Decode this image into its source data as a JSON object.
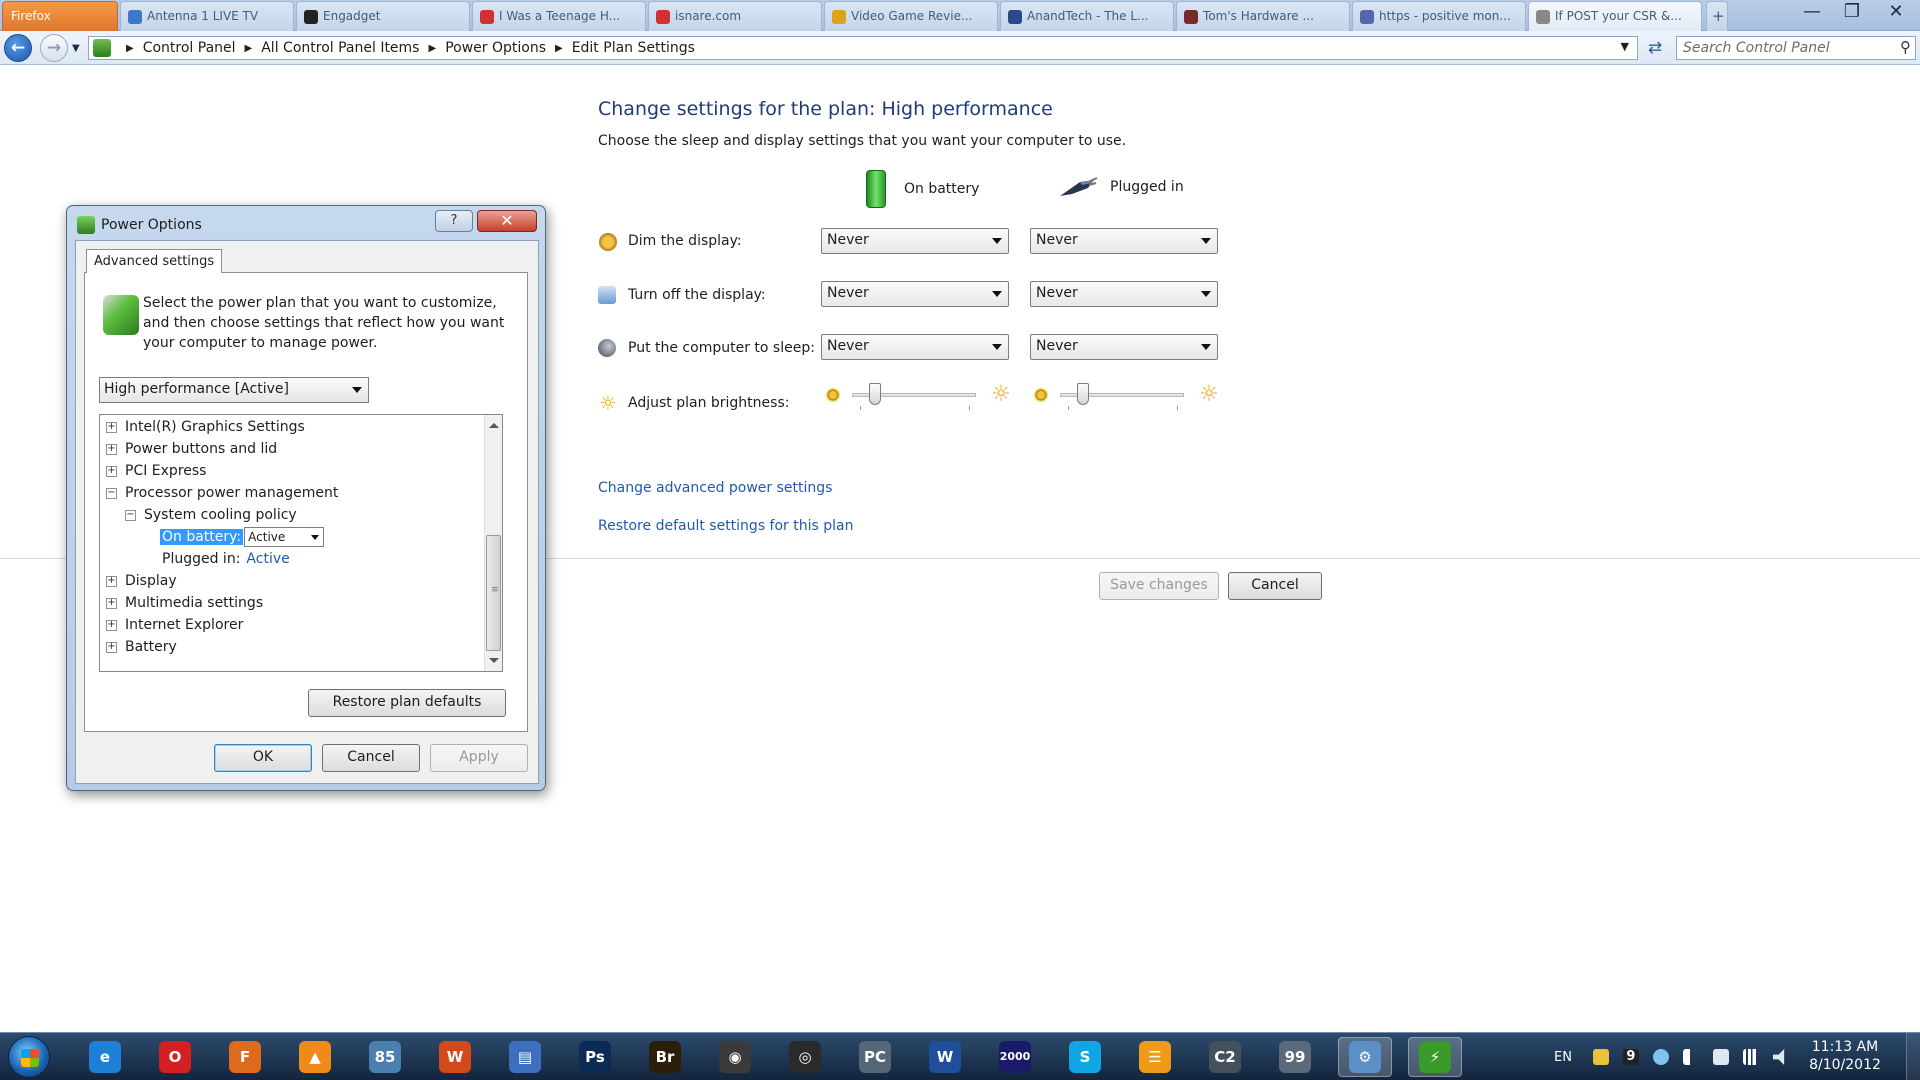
{
  "browser": {
    "tabs": [
      {
        "label": "Firefox",
        "color": "#e2762a"
      },
      {
        "label": "Antenna 1 LIVE TV",
        "color": "#3c78c8"
      },
      {
        "label": "Engadget",
        "color": "#222222"
      },
      {
        "label": "I Was a Teenage H...",
        "color": "#cc3333"
      },
      {
        "label": "isnare.com",
        "color": "#d03030"
      },
      {
        "label": "Video Game Revie...",
        "color": "#e0a020"
      },
      {
        "label": "AnandTech - The L...",
        "color": "#2a4a8a"
      },
      {
        "label": "Tom's Hardware ...",
        "color": "#7a2a2a"
      },
      {
        "label": "https - positive mon...",
        "color": "#5566aa"
      },
      {
        "label": "If POST your CSR &...",
        "color": "#888888"
      }
    ],
    "new_tab": "+",
    "window": {
      "minimize": "—",
      "maximize": "❐",
      "close": "✕"
    }
  },
  "address": {
    "crumbs": [
      "Control Panel",
      "All Control Panel Items",
      "Power Options",
      "Edit Plan Settings"
    ],
    "search_placeholder": "Search Control Panel"
  },
  "main": {
    "title": "Change settings for the plan: High performance",
    "subtitle": "Choose the sleep and display settings that you want your computer to use.",
    "columns": {
      "battery": "On battery",
      "plugged": "Plugged in"
    },
    "rows": [
      {
        "label": "Dim the display:",
        "battery": "Never",
        "plugged": "Never",
        "icon": "dim-display-icon"
      },
      {
        "label": "Turn off the display:",
        "battery": "Never",
        "plugged": "Never",
        "icon": "monitor-off-icon"
      },
      {
        "label": "Put the computer to sleep:",
        "battery": "Never",
        "plugged": "Never",
        "icon": "sleep-moon-icon"
      }
    ],
    "brightness_label": "Adjust plan brightness:",
    "brightness": {
      "battery": 0.15,
      "plugged": 0.15
    },
    "links": {
      "advanced": "Change advanced power settings",
      "restore": "Restore default settings for this plan"
    },
    "buttons": {
      "save": "Save changes",
      "cancel": "Cancel"
    }
  },
  "dialog": {
    "title": "Power Options",
    "help": "?",
    "close": "✕",
    "tab": "Advanced settings",
    "description": "Select the power plan that you want to customize, and then choose settings that reflect how you want your computer to manage power.",
    "plan_select": "High performance [Active]",
    "tree": [
      {
        "label": "Intel(R) Graphics Settings",
        "expander": "+"
      },
      {
        "label": "Power buttons and lid",
        "expander": "+"
      },
      {
        "label": "PCI Express",
        "expander": "+"
      },
      {
        "label": "Processor power management",
        "expander": "−"
      },
      {
        "label": "System cooling policy",
        "expander": "−"
      },
      {
        "label": "On battery:",
        "value": "Active"
      },
      {
        "label": "Plugged in:",
        "value": "Active"
      },
      {
        "label": "Display",
        "expander": "+"
      },
      {
        "label": "Multimedia settings",
        "expander": "+"
      },
      {
        "label": "Internet Explorer",
        "expander": "+"
      },
      {
        "label": "Battery",
        "expander": "+"
      }
    ],
    "restore_button": "Restore plan defaults",
    "ok": "OK",
    "cancel": "Cancel",
    "apply": "Apply"
  },
  "taskbar": {
    "apps": [
      {
        "name": "internet-explorer",
        "glyph": "e",
        "color": "#1e7fd6"
      },
      {
        "name": "opera",
        "glyph": "O",
        "color": "#d42020"
      },
      {
        "name": "firefox",
        "glyph": "F",
        "color": "#e06a1c"
      },
      {
        "name": "vlc",
        "glyph": "▲",
        "color": "#f08a18"
      },
      {
        "name": "winamp",
        "glyph": "85",
        "color": "#4a7fb0"
      },
      {
        "name": "wow",
        "glyph": "W",
        "color": "#d04a1a"
      },
      {
        "name": "floppy",
        "glyph": "▤",
        "color": "#3d6fbf"
      },
      {
        "name": "photoshop",
        "glyph": "Ps",
        "color": "#0b2a55"
      },
      {
        "name": "bridge",
        "glyph": "Br",
        "color": "#2b1e0a"
      },
      {
        "name": "camera",
        "glyph": "◉",
        "color": "#3a3a3a"
      },
      {
        "name": "media-disc",
        "glyph": "◎",
        "color": "#2a2a2a"
      },
      {
        "name": "pc-tool",
        "glyph": "PC",
        "color": "#556677"
      },
      {
        "name": "word",
        "glyph": "W",
        "color": "#1f4e9a"
      },
      {
        "name": "ardt-2000",
        "glyph": "2000",
        "color": "#1a1a6a"
      },
      {
        "name": "skype",
        "glyph": "S",
        "color": "#12a5e6"
      },
      {
        "name": "orange-app",
        "glyph": "☰",
        "color": "#f09a1a"
      },
      {
        "name": "game-c2",
        "glyph": "C2",
        "color": "#44505c"
      },
      {
        "name": "monitor-99",
        "glyph": "99",
        "color": "#5a6a7a"
      },
      {
        "name": "control-panel",
        "glyph": "⚙",
        "color": "#5a8fc8"
      },
      {
        "name": "power-options",
        "glyph": "⚡",
        "color": "#3a9a2a"
      }
    ],
    "tray": {
      "language": "EN",
      "badge": "9"
    },
    "clock": {
      "time": "11:13 AM",
      "date": "8/10/2012"
    }
  }
}
